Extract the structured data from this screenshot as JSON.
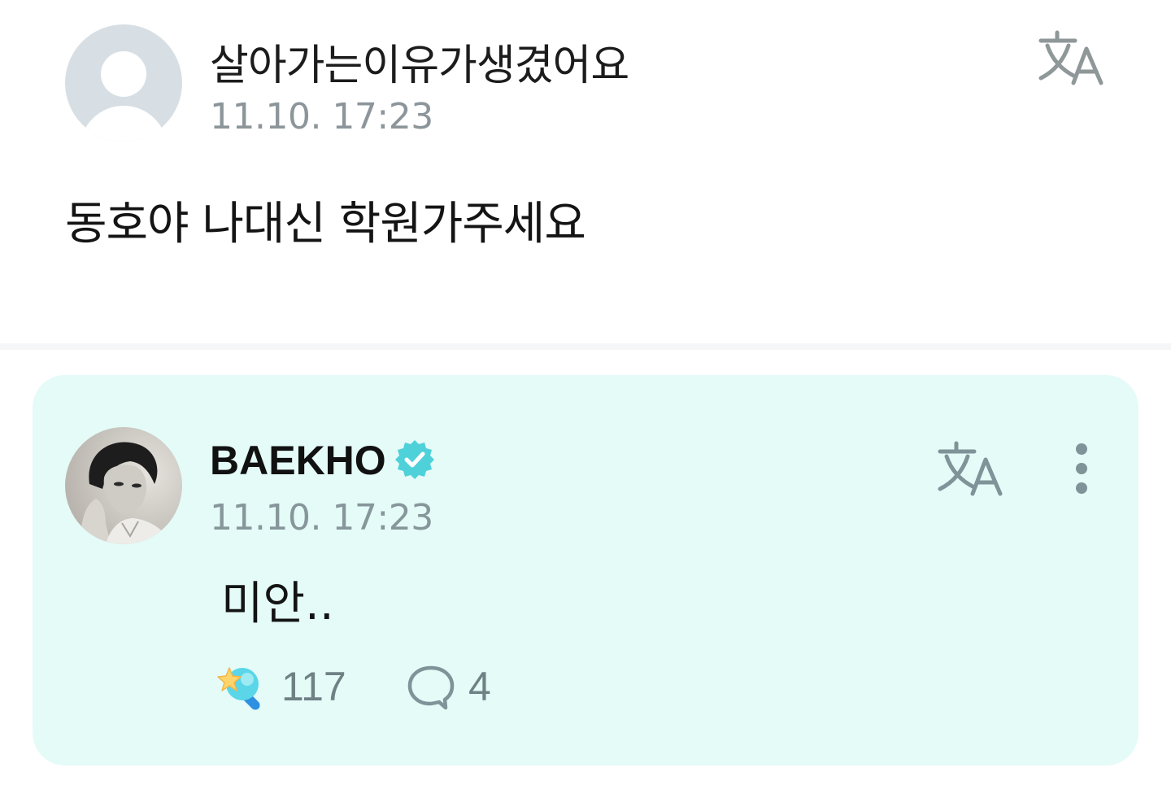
{
  "fan_post": {
    "author": "살아가는이유가생겼어요",
    "timestamp": "11.10. 17:23",
    "text": "동호야 나대신 학원가주세요",
    "translate_icon": "translate-icon",
    "avatar_icon": "default-avatar-icon"
  },
  "artist_reply": {
    "author": "BAEKHO",
    "verified": true,
    "verified_icon": "verified-badge-icon",
    "timestamp": "11.10. 17:23",
    "text": "미안..",
    "translate_icon": "translate-icon",
    "more_icon": "more-vertical-icon",
    "likes": "117",
    "like_icon": "star-wand-icon",
    "comments": "4",
    "comment_icon": "speech-bubble-icon"
  },
  "colors": {
    "card_background": "#e4fbf8",
    "accent": "#4fd1d9",
    "meta_text": "#8c959a",
    "icon_gray": "#7e9498"
  }
}
